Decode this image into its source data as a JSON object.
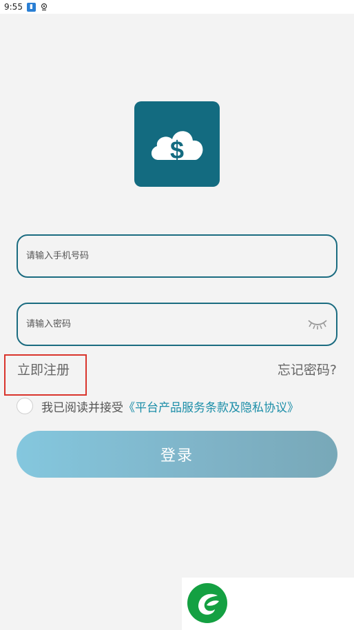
{
  "status_bar": {
    "time": "9:55",
    "icons": [
      "app-notification-icon",
      "location-icon"
    ]
  },
  "logo": {
    "icon": "cloud-dollar-icon",
    "glyph": "$",
    "background_color": "#136b80"
  },
  "form": {
    "phone_placeholder": "请输入手机号码",
    "password_placeholder": "请输入密码",
    "password_toggle_icon": "eye-closed-icon",
    "border_color": "#1a6b80"
  },
  "links": {
    "register": "立即注册",
    "forgot_password": "忘记密码?"
  },
  "agreement": {
    "checked": false,
    "prefix": "我已阅读并接受",
    "terms": "《平台产品服务条款及隐私协议》",
    "link_color": "#1c8ea8"
  },
  "login_button": {
    "label": "登录"
  },
  "annotation": {
    "highlight_color": "#d9332b",
    "target": "register"
  },
  "footer": {
    "icon": "green-leaf-logo-icon"
  }
}
